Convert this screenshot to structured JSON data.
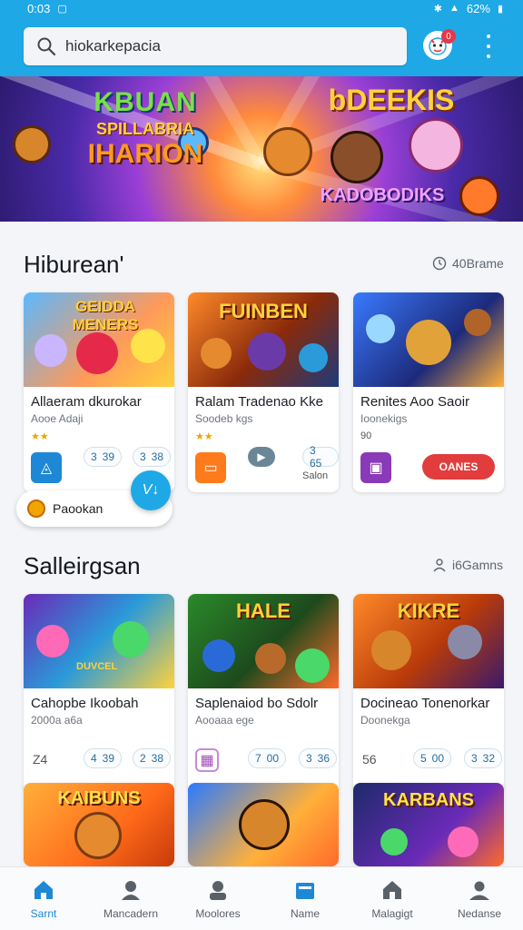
{
  "status_bar": {
    "time": "0:03",
    "battery": "62%"
  },
  "search": {
    "value": "hiokarkepacia"
  },
  "notifications": {
    "badge": "0"
  },
  "banner": {
    "left_title_1": "KBUAN",
    "left_title_2": "SPILLABRIA",
    "left_title_3": "IHARION",
    "right_title_1": "bDEEKIS",
    "right_title_2": "KADOBODIKS"
  },
  "section_1": {
    "title": "Hiburean'",
    "meta": "40Brame",
    "cards": [
      {
        "title": "Allaeram dkurokar",
        "subtitle": "Aooe Adaji",
        "stars": "★★",
        "pill_1": "3 39",
        "pill_2": "3 38",
        "thumb_label": "GEIDDA MENERS"
      },
      {
        "title": "Ralam Tradenao Kke",
        "subtitle": "Soodeb kgs",
        "stars": "★★",
        "pill_1": "▶",
        "pill_2": "3 65",
        "extra": "Salon",
        "thumb_label": "FUINBEN"
      },
      {
        "title": "Renites Aoo Saoir",
        "subtitle": "Ioonekigs",
        "stars": "90",
        "button": "OANES",
        "thumb_label": ""
      }
    ],
    "chip": {
      "label": "Paookan"
    }
  },
  "section_2": {
    "title": "Salleirgsan",
    "meta": "i6Gamns",
    "cards": [
      {
        "title": "Cahopbe Ikoobah",
        "subtitle": "2000a a6a",
        "num": "Z4",
        "pill_1": "4 39",
        "pill_2": "2 38",
        "thumb_label": "DUVCEL"
      },
      {
        "title": "Saplenaiod bo Sdolr",
        "subtitle": "Aooaaa ege",
        "pill_1": "7 00",
        "pill_2": "3 36",
        "thumb_label": "HALE"
      },
      {
        "title": "Docineao Tonenorkar",
        "subtitle": "Doonekga",
        "num": "56",
        "pill_1": "5 00",
        "pill_2": "3 32",
        "thumb_label": "KIKRE"
      }
    ],
    "row2_labels": [
      "KAIBUNS",
      "",
      "KARBANS"
    ]
  },
  "bottom_nav": [
    {
      "label": "Sarnt"
    },
    {
      "label": "Mancadern"
    },
    {
      "label": "Moolores"
    },
    {
      "label": "Name"
    },
    {
      "label": "Malagigt"
    },
    {
      "label": "Nedanse"
    }
  ]
}
